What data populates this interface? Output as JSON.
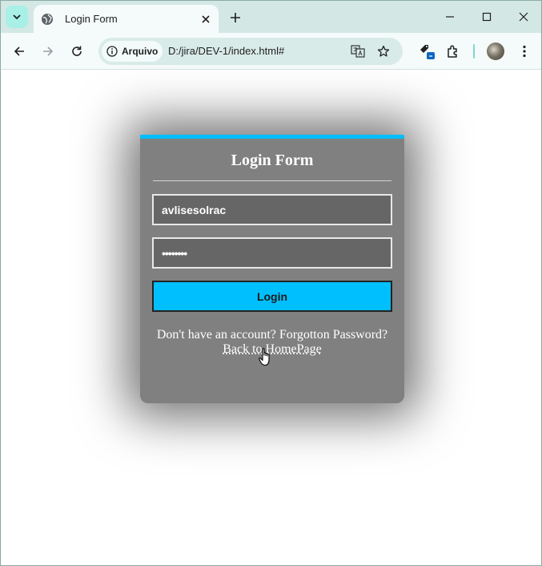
{
  "browser": {
    "tab_title": "Login Form",
    "security_chip_label": "Arquivo",
    "url": "D:/jira/DEV-1/index.html#"
  },
  "form": {
    "heading": "Login Form",
    "username_value": "avlisesolrac",
    "password_value": "••••••••",
    "login_label": "Login",
    "signup_text": "Don't have an account?",
    "forgot_text": "Forgotton Password?",
    "back_link_text": "Back to HomePage"
  },
  "colors": {
    "accent": "#00bfff",
    "card_bg": "#808080",
    "input_bg": "#666666",
    "tabbar_bg": "#d3e8e4"
  },
  "icons": [
    "tab-search-icon",
    "globe-icon",
    "close-icon",
    "plus-icon",
    "minimize-icon",
    "maximize-icon",
    "back-icon",
    "forward-icon",
    "reload-icon",
    "info-icon",
    "translate-icon",
    "star-icon",
    "tag-icon",
    "extensions-icon",
    "kebab-menu-icon",
    "hand-cursor-icon"
  ]
}
